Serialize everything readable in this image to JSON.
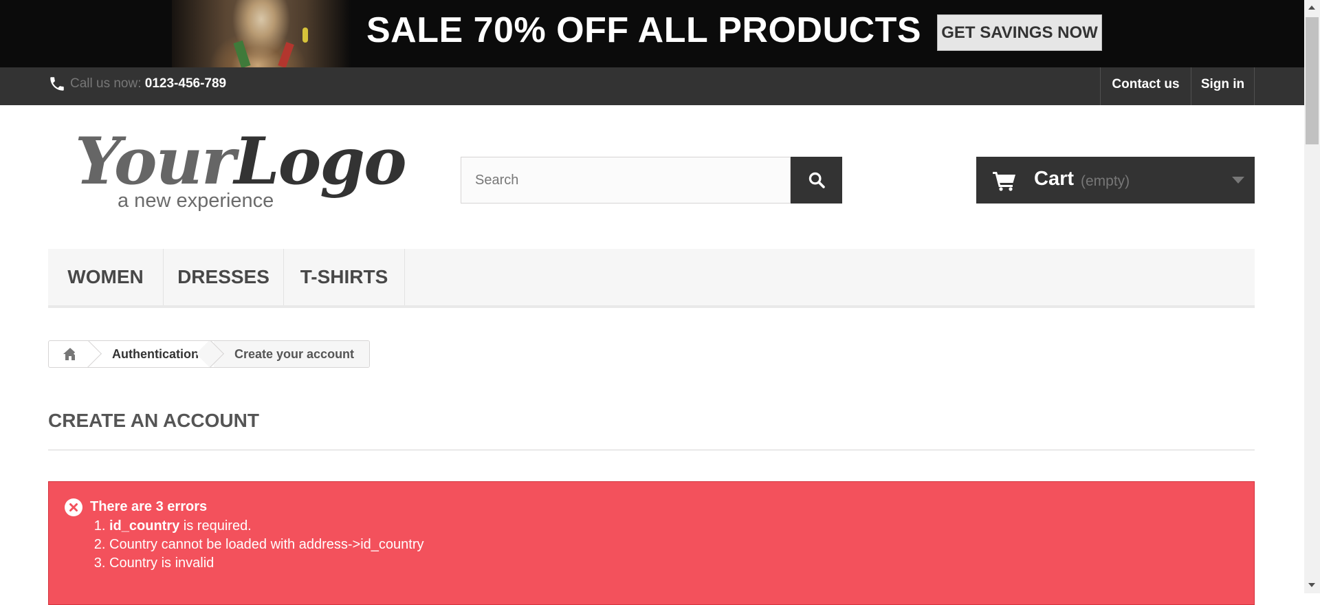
{
  "banner": {
    "headline": "SALE 70% OFF ALL PRODUCTS",
    "button_label": "GET SAVINGS NOW"
  },
  "header_nav": {
    "phone_label": "Call us now:",
    "phone_number": "0123-456-789",
    "contact_label": "Contact us",
    "signin_label": "Sign in"
  },
  "logo": {
    "main_light": "Your",
    "main_dark": "Logo",
    "tagline": "a new experience"
  },
  "search": {
    "placeholder": "Search"
  },
  "cart": {
    "label": "Cart",
    "status": "(empty)"
  },
  "menu": {
    "items": [
      {
        "label": "WOMEN"
      },
      {
        "label": "DRESSES"
      },
      {
        "label": "T-SHIRTS"
      }
    ]
  },
  "breadcrumb": {
    "items": [
      {
        "label": "Authentication"
      },
      {
        "label": "Create your account"
      }
    ]
  },
  "page": {
    "title": "CREATE AN ACCOUNT"
  },
  "alert": {
    "heading": "There are 3 errors",
    "errors": [
      {
        "strong": "id_country",
        "rest": " is required."
      },
      {
        "strong": "",
        "rest": "Country cannot be loaded with address->id_country"
      },
      {
        "strong": "",
        "rest": "Country is invalid"
      }
    ],
    "color": "#f3515c"
  },
  "theme": {
    "dark": "#333333",
    "nav_border": "#515151"
  }
}
